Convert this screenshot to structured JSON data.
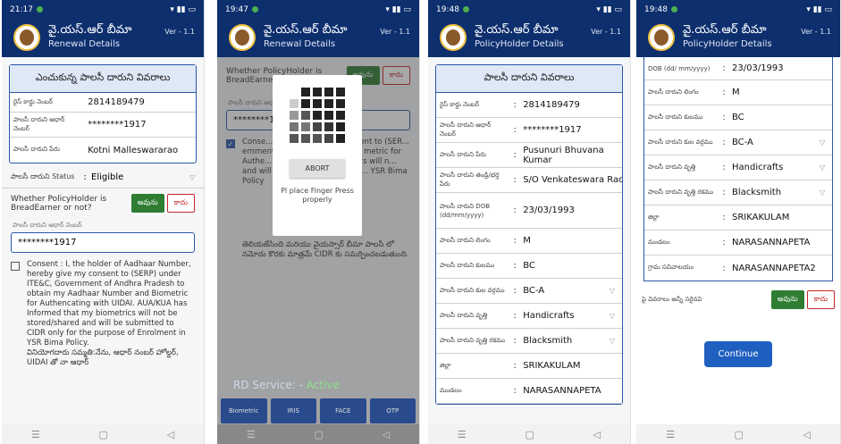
{
  "app": {
    "title": "వై.యస్.ఆర్ బీమా",
    "version": "Ver - 1.1"
  },
  "screens": [
    {
      "time": "21:17",
      "subtitle": "Renewal Details"
    },
    {
      "time": "19:47",
      "subtitle": "Renewal Details"
    },
    {
      "time": "19:48",
      "subtitle": "PolicyHolder Details"
    },
    {
      "time": "19:48",
      "subtitle": "PolicyHolder Details"
    }
  ],
  "renewal": {
    "card_title": "ఎంచుకున్న పాలసీ దారుని వివరాలు",
    "rows": [
      {
        "label": "రైస్ కార్డు నెంబర్",
        "value": "2814189479"
      },
      {
        "label": "పాలసీ దారుని ఆధార్ నెంబర్",
        "value": "********1917"
      },
      {
        "label": "పాలసీ దారుని పేరు",
        "value": "Kotni Malleswararao"
      }
    ],
    "status_label": "పాలసీ దారుని Status",
    "status_value": "Eligible",
    "question": "Whether PolicyHolder is BreadEarner or not?",
    "yes": "అవును",
    "no": "కాదు",
    "aadhaar_label": "పాలసీ దారుని ఆధార్ నెంబర్",
    "aadhaar_value": "********1917",
    "consent": "Consent : I, the holder of Aadhaar Number, hereby give my consent to (SERP) under ITE&C, Government of Andhra Pradesh to obtain my Aadhaar Number and Biometric for Authencating with UIDAI. AUA/KUA has Informed that my biometrics will not be stored/shared and will be submitted to CIDR only for the purpose of Enrolment in YSR Bima Policy.",
    "consent_te": "వినియోగదారు సమ్మతి:నేను, ఆధార్ నంబర్ హోల్డర్, UIDAI తో నా ఆధార్"
  },
  "scan": {
    "abort": "ABORT",
    "message": "Pl place Finger Press properly",
    "consent_short": "Conse... Aadhaar Numb... consent to (SER... ernment of An... in my Aadha... metric for Authe... AUA/KUA has I... metrics will n... and will be su... y for the purpo... YSR Bima Policy",
    "consent_te": "తెలియజేసింది మరియు వైయస్సార్ బీమా పాలసీ లో నమోదు కొరకు మాత్రమే CIDR కు సమర్పించబడుతుంది.",
    "rd_label": "RD Service: -",
    "rd_status": "Active",
    "buttons": [
      "Biometric",
      "IRIS",
      "FACE",
      "OTP"
    ]
  },
  "holder": {
    "card_title": "పాలసీ దారుని వివరాలు",
    "rows": [
      {
        "label": "రైస్ కార్డు నెంబర్",
        "value": "2814189479"
      },
      {
        "label": "పాలసీ దారుని ఆధార్ నెంబర్",
        "value": "********1917"
      },
      {
        "label": "పాలసీ దారుని పేరు",
        "value": "Pusunuri Bhuvana Kumar"
      },
      {
        "label": "పాలసీ దారుని తండ్రి/భర్త పేరు",
        "value": "S/O Venkateswara Rao"
      },
      {
        "label": "పాలసీ దారుని DOB (dd/mm/yyyy)",
        "value": "23/03/1993"
      },
      {
        "label": "పాలసీ దారుని లింగం",
        "value": "M"
      },
      {
        "label": "పాలసీ దారుని కులము",
        "value": "BC"
      },
      {
        "label": "పాలసీ దారుని కుల వర్గము",
        "value": "BC-A"
      },
      {
        "label": "పాలసీ దారుని వృత్తి",
        "value": "Handicrafts"
      },
      {
        "label": "పాలసీ దారుని వృత్తి రకము",
        "value": "Blacksmith"
      },
      {
        "label": "జిల్లా",
        "value": "SRIKAKULAM"
      },
      {
        "label": "మండలం",
        "value": "NARASANNAPETA"
      }
    ]
  },
  "holder2": {
    "rows": [
      {
        "label": "DOB (dd/ mm/yyyy)",
        "value": "23/03/1993"
      },
      {
        "label": "పాలసీ దారుని లింగం",
        "value": "M"
      },
      {
        "label": "పాలసీ దారుని కులము",
        "value": "BC"
      },
      {
        "label": "పాలసీ దారుని కుల వర్గము",
        "value": "BC-A"
      },
      {
        "label": "పాలసీ దారుని వృత్తి",
        "value": "Handicrafts"
      },
      {
        "label": "పాలసీ దారుని వృత్తి రకము",
        "value": "Blacksmith"
      },
      {
        "label": "జిల్లా",
        "value": "SRIKAKULAM"
      },
      {
        "label": "మండలం",
        "value": "NARASANNAPETA"
      },
      {
        "label": "గ్రామ సచివాలయం",
        "value": "NARASANNAPETA2"
      }
    ],
    "confirm": "పై వివరాలు అన్నీ సరైనవి",
    "continue": "Continue"
  }
}
